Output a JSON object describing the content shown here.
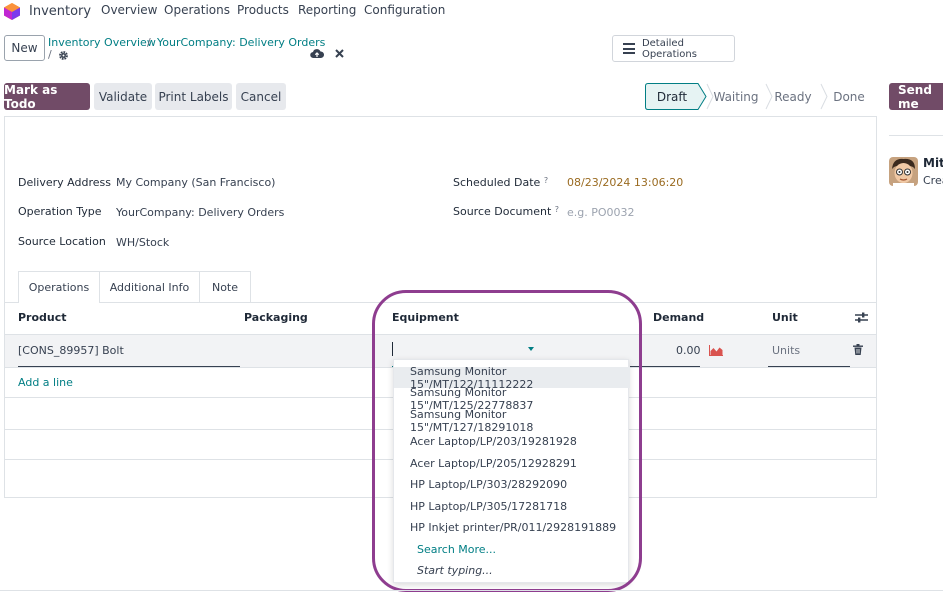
{
  "nav": {
    "app_title": "Inventory",
    "menu": [
      "Overview",
      "Operations",
      "Products",
      "Reporting",
      "Configuration"
    ]
  },
  "control": {
    "new_label": "New",
    "breadcrumb_parent": "Inventory Overview",
    "breadcrumb_sep": "/",
    "breadcrumb_current": "YourCompany: Delivery Orders",
    "record_sep": "/",
    "detailed_ops_label": "Detailed Operations"
  },
  "actions": {
    "mark_todo": "Mark as Todo",
    "validate": "Validate",
    "print_labels": "Print Labels",
    "cancel": "Cancel"
  },
  "status": {
    "stages": [
      "Draft",
      "Waiting",
      "Ready",
      "Done"
    ],
    "active": "Draft"
  },
  "chatter": {
    "send_label": "Send me",
    "author_partial": "Mite",
    "activity_partial": "Crea"
  },
  "form": {
    "delivery_address_label": "Delivery Address",
    "delivery_address_value": "My Company (San Francisco)",
    "operation_type_label": "Operation Type",
    "operation_type_value": "YourCompany: Delivery Orders",
    "source_location_label": "Source Location",
    "source_location_value": "WH/Stock",
    "scheduled_date_label": "Scheduled Date",
    "scheduled_date_value": "08/23/2024 13:06:20",
    "source_document_label": "Source Document",
    "source_document_placeholder": "e.g. PO0032",
    "help_mark": "?"
  },
  "tabs": [
    "Operations",
    "Additional Info",
    "Note"
  ],
  "table": {
    "headers": {
      "product": "Product",
      "packaging": "Packaging",
      "equipment": "Equipment",
      "demand": "Demand",
      "unit": "Unit"
    },
    "row": {
      "product": "[CONS_89957] Bolt",
      "demand": "0.00",
      "unit": "Units"
    },
    "add_line": "Add a line"
  },
  "dropdown": {
    "options": [
      "Samsung Monitor 15\"/MT/122/11112222",
      "Samsung Monitor 15\"/MT/125/22778837",
      "Samsung Monitor 15\"/MT/127/18291018",
      "Acer Laptop/LP/203/19281928",
      "Acer Laptop/LP/205/12928291",
      "HP Laptop/LP/303/28292090",
      "HP Laptop/LP/305/17281718",
      "HP Inkjet printer/PR/011/2928191889"
    ],
    "search_more": "Search More...",
    "start_typing": "Start typing..."
  },
  "colors": {
    "brand": "#714b67",
    "link": "#017e84",
    "highlight": "#8e3d8f",
    "date": "#9a6b21"
  }
}
